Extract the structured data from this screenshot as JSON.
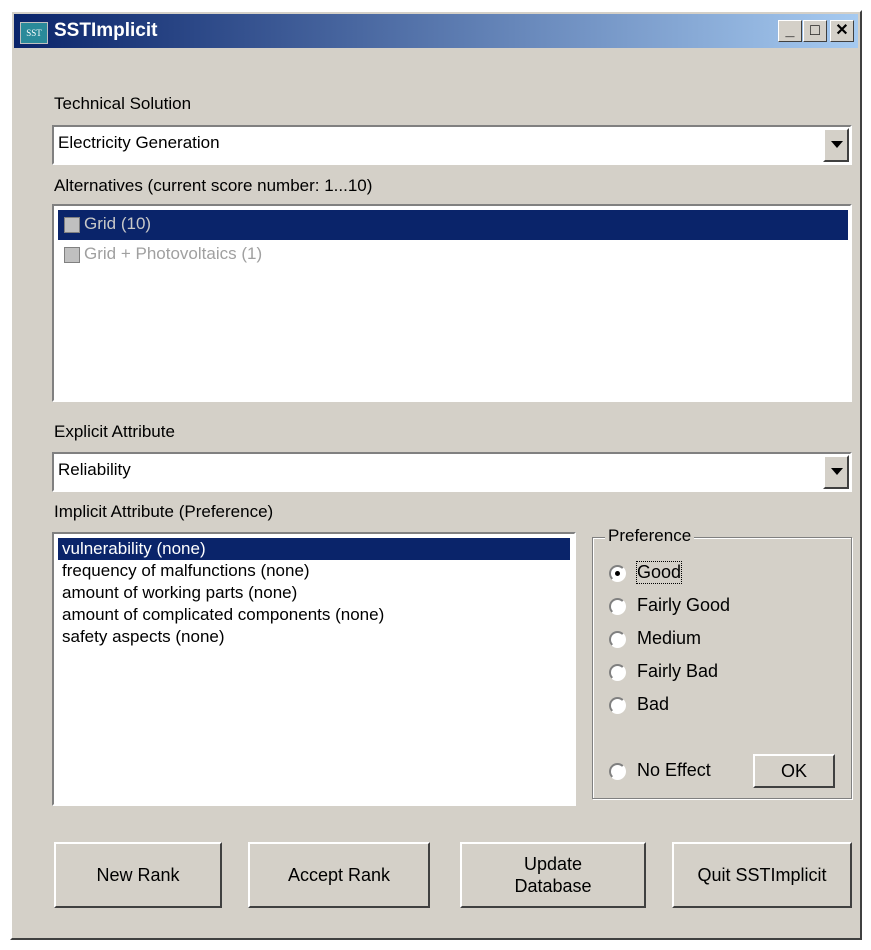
{
  "window": {
    "title": "SSTImplicit",
    "icon_text": "SST",
    "buttons": {
      "minimize": "_",
      "maximize": "□",
      "close": "✕"
    }
  },
  "technical_solution": {
    "label": "Technical Solution",
    "selected": "Electricity Generation"
  },
  "alternatives": {
    "label": "Alternatives (current score number: 1...10)",
    "items": [
      {
        "label": "Grid (10)",
        "selected": true
      },
      {
        "label": "Grid + Photovoltaics (1)",
        "selected": false
      }
    ]
  },
  "explicit_attribute": {
    "label": "Explicit Attribute",
    "selected": "Reliability"
  },
  "implicit_attribute": {
    "label": "Implicit Attribute (Preference)",
    "items": [
      "vulnerability (none)",
      "frequency of malfunctions (none)",
      "amount of working parts (none)",
      "amount of complicated components (none)",
      "safety aspects (none)"
    ],
    "selected_index": 0
  },
  "preference": {
    "label": "Preference",
    "options": [
      "Good",
      "Fairly Good",
      "Medium",
      "Fairly Bad",
      "Bad",
      "No Effect"
    ],
    "selected": "Good",
    "ok_label": "OK"
  },
  "actions": {
    "new_rank": "New Rank",
    "accept_rank": "Accept Rank",
    "update_database": "Update\nDatabase",
    "quit": "Quit SSTImplicit"
  },
  "colors": {
    "title_bar": "#0a246a",
    "selection": "#0a246a",
    "face": "#d4d0c8"
  }
}
